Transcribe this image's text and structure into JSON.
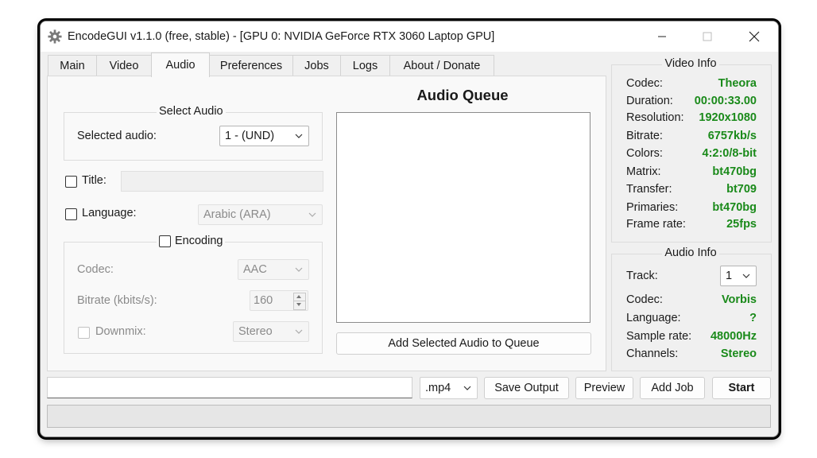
{
  "window": {
    "title": "EncodeGUI v1.1.0 (free, stable) - [GPU 0: NVIDIA GeForce RTX 3060 Laptop GPU]"
  },
  "tabs": [
    "Main",
    "Video",
    "Audio",
    "Preferences",
    "Jobs",
    "Logs",
    "About / Donate"
  ],
  "active_tab": "Audio",
  "audio": {
    "select_audio_legend": "Select Audio",
    "selected_audio_label": "Selected audio:",
    "selected_audio_value": "1 - (UND)",
    "title_label": "Title:",
    "title_value": "",
    "language_label": "Language:",
    "language_value": "Arabic (ARA)",
    "encoding_label": "Encoding",
    "codec_label": "Codec:",
    "codec_value": "AAC",
    "bitrate_label": "Bitrate (kbits/s):",
    "bitrate_value": "160",
    "downmix_label": "Downmix:",
    "downmix_value": "Stereo",
    "queue_title": "Audio Queue",
    "add_queue_button": "Add Selected Audio to Queue"
  },
  "video_info": {
    "legend": "Video Info",
    "rows": [
      {
        "label": "Codec:",
        "value": "Theora"
      },
      {
        "label": "Duration:",
        "value": "00:00:33.00"
      },
      {
        "label": "Resolution:",
        "value": "1920x1080"
      },
      {
        "label": "Bitrate:",
        "value": "6757kb/s"
      },
      {
        "label": "Colors:",
        "value": "4:2:0/8-bit"
      },
      {
        "label": "Matrix:",
        "value": "bt470bg"
      },
      {
        "label": "Transfer:",
        "value": "bt709"
      },
      {
        "label": "Primaries:",
        "value": "bt470bg"
      },
      {
        "label": "Frame rate:",
        "value": "25fps"
      }
    ]
  },
  "audio_info": {
    "legend": "Audio Info",
    "track_label": "Track:",
    "track_value": "1",
    "rows": [
      {
        "label": "Codec:",
        "value": "Vorbis"
      },
      {
        "label": "Language:",
        "value": "?"
      },
      {
        "label": "Sample rate:",
        "value": "48000Hz"
      },
      {
        "label": "Channels:",
        "value": "Stereo"
      }
    ]
  },
  "bottom": {
    "output_path": "",
    "extension": ".mp4",
    "save_output": "Save Output",
    "preview": "Preview",
    "add_job": "Add Job",
    "start": "Start"
  },
  "colors": {
    "info_value": "#1a8a1a"
  }
}
